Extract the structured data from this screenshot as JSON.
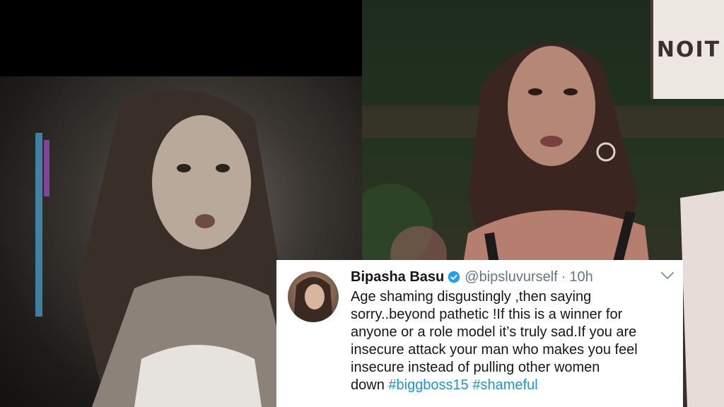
{
  "tweet": {
    "display_name": "Bipasha Basu",
    "handle": "@bipsluvurself",
    "separator": "·",
    "time": "10h",
    "text": "Age shaming disgustingly ,then saying\nsorry..beyond pathetic !If this is a winner for\nanyone or a role model it’s truly sad.If you are\ninsecure attack your man who makes you feel\ninsecure instead of pulling  other women\ndown ",
    "hashtags": [
      "#biggboss15",
      "#shameful"
    ],
    "icons": {
      "verified": "verified-badge-icon",
      "menu": "chevron-down-icon"
    },
    "colors": {
      "hashtag": "#1b95e0",
      "verified": "#1da1f2"
    }
  },
  "background_sign": {
    "text": "NOIT"
  }
}
